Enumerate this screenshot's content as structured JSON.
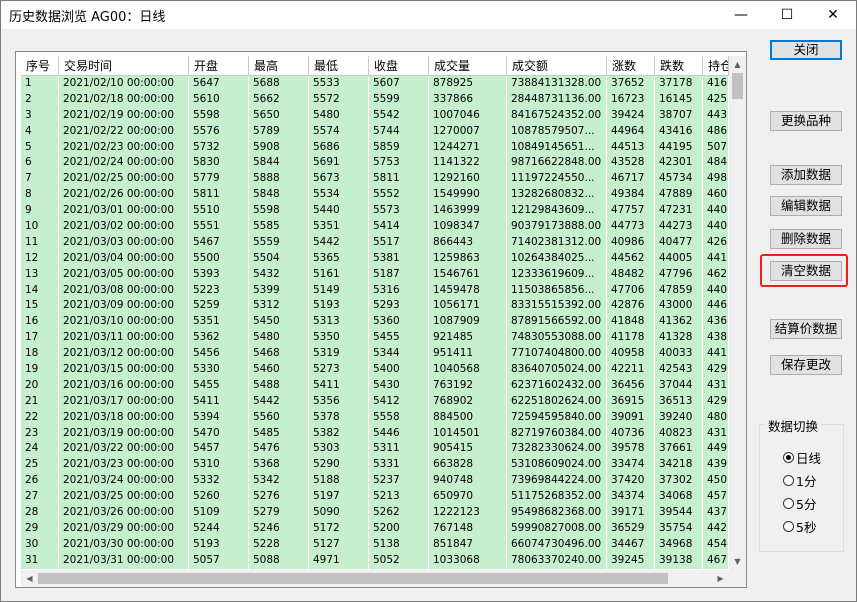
{
  "window": {
    "title": "历史数据浏览 AG00：日线",
    "minimize_glyph": "—",
    "maximize_glyph": "☐",
    "close_glyph": "✕"
  },
  "table": {
    "headers": [
      "序号",
      "交易时间",
      "开盘",
      "最高",
      "最低",
      "收盘",
      "成交量",
      "成交额",
      "涨数",
      "跌数",
      "持仓"
    ],
    "rows": [
      [
        "1",
        "2021/02/10 00:00:00",
        "5647",
        "5688",
        "5533",
        "5607",
        "878925",
        "73884131328.00",
        "37652",
        "37178",
        "416"
      ],
      [
        "2",
        "2021/02/18 00:00:00",
        "5610",
        "5662",
        "5572",
        "5599",
        "337866",
        "28448731136.00",
        "16723",
        "16145",
        "425"
      ],
      [
        "3",
        "2021/02/19 00:00:00",
        "5598",
        "5650",
        "5480",
        "5542",
        "1007046",
        "84167524352.00",
        "39424",
        "38707",
        "443"
      ],
      [
        "4",
        "2021/02/22 00:00:00",
        "5576",
        "5789",
        "5574",
        "5744",
        "1270007",
        "10878579507...",
        "44964",
        "43416",
        "486"
      ],
      [
        "5",
        "2021/02/23 00:00:00",
        "5732",
        "5908",
        "5686",
        "5859",
        "1244271",
        "10849145651...",
        "44513",
        "44195",
        "507"
      ],
      [
        "6",
        "2021/02/24 00:00:00",
        "5830",
        "5844",
        "5691",
        "5753",
        "1141322",
        "98716622848.00",
        "43528",
        "42301",
        "484"
      ],
      [
        "7",
        "2021/02/25 00:00:00",
        "5779",
        "5888",
        "5673",
        "5811",
        "1292160",
        "11197224550...",
        "46717",
        "45734",
        "498"
      ],
      [
        "8",
        "2021/02/26 00:00:00",
        "5811",
        "5848",
        "5534",
        "5552",
        "1549990",
        "13282680832...",
        "49384",
        "47889",
        "460"
      ],
      [
        "9",
        "2021/03/01 00:00:00",
        "5510",
        "5598",
        "5440",
        "5573",
        "1463999",
        "12129843609...",
        "47757",
        "47231",
        "440"
      ],
      [
        "10",
        "2021/03/02 00:00:00",
        "5551",
        "5585",
        "5351",
        "5414",
        "1098347",
        "90379173888.00",
        "44773",
        "44273",
        "440"
      ],
      [
        "11",
        "2021/03/03 00:00:00",
        "5467",
        "5559",
        "5442",
        "5517",
        "866443",
        "71402381312.00",
        "40986",
        "40477",
        "426"
      ],
      [
        "12",
        "2021/03/04 00:00:00",
        "5500",
        "5504",
        "5365",
        "5381",
        "1259863",
        "10264384025...",
        "44562",
        "44005",
        "441"
      ],
      [
        "13",
        "2021/03/05 00:00:00",
        "5393",
        "5432",
        "5161",
        "5187",
        "1546761",
        "12333619609...",
        "48482",
        "47796",
        "462"
      ],
      [
        "14",
        "2021/03/08 00:00:00",
        "5223",
        "5399",
        "5149",
        "5316",
        "1459478",
        "11503865856...",
        "47706",
        "47859",
        "440"
      ],
      [
        "15",
        "2021/03/09 00:00:00",
        "5259",
        "5312",
        "5193",
        "5293",
        "1056171",
        "83315515392.00",
        "42876",
        "43000",
        "446"
      ],
      [
        "16",
        "2021/03/10 00:00:00",
        "5351",
        "5450",
        "5313",
        "5360",
        "1087909",
        "87891566592.00",
        "41848",
        "41362",
        "436"
      ],
      [
        "17",
        "2021/03/11 00:00:00",
        "5362",
        "5480",
        "5350",
        "5455",
        "921485",
        "74830553088.00",
        "41178",
        "41328",
        "438"
      ],
      [
        "18",
        "2021/03/12 00:00:00",
        "5456",
        "5468",
        "5319",
        "5344",
        "951411",
        "77107404800.00",
        "40958",
        "40033",
        "441"
      ],
      [
        "19",
        "2021/03/15 00:00:00",
        "5330",
        "5460",
        "5273",
        "5400",
        "1040568",
        "83640705024.00",
        "42211",
        "42543",
        "429"
      ],
      [
        "20",
        "2021/03/16 00:00:00",
        "5455",
        "5488",
        "5411",
        "5430",
        "763192",
        "62371602432.00",
        "36456",
        "37044",
        "431"
      ],
      [
        "21",
        "2021/03/17 00:00:00",
        "5411",
        "5442",
        "5356",
        "5412",
        "768902",
        "62251802624.00",
        "36915",
        "36513",
        "429"
      ],
      [
        "22",
        "2021/03/18 00:00:00",
        "5394",
        "5560",
        "5378",
        "5558",
        "884500",
        "72594595840.00",
        "39091",
        "39240",
        "480"
      ],
      [
        "23",
        "2021/03/19 00:00:00",
        "5470",
        "5485",
        "5382",
        "5446",
        "1014501",
        "82719760384.00",
        "40736",
        "40823",
        "431"
      ],
      [
        "24",
        "2021/03/22 00:00:00",
        "5457",
        "5476",
        "5303",
        "5311",
        "905415",
        "73282330624.00",
        "39578",
        "37661",
        "449"
      ],
      [
        "25",
        "2021/03/23 00:00:00",
        "5310",
        "5368",
        "5290",
        "5331",
        "663828",
        "53108609024.00",
        "33474",
        "34218",
        "439"
      ],
      [
        "26",
        "2021/03/24 00:00:00",
        "5332",
        "5342",
        "5188",
        "5237",
        "940748",
        "73969844224.00",
        "37420",
        "37302",
        "450"
      ],
      [
        "27",
        "2021/03/25 00:00:00",
        "5260",
        "5276",
        "5197",
        "5213",
        "650970",
        "51175268352.00",
        "34374",
        "34068",
        "457"
      ],
      [
        "28",
        "2021/03/26 00:00:00",
        "5109",
        "5279",
        "5090",
        "5262",
        "1222123",
        "95498682368.00",
        "39171",
        "39544",
        "437"
      ],
      [
        "29",
        "2021/03/29 00:00:00",
        "5244",
        "5246",
        "5172",
        "5200",
        "767148",
        "59990827008.00",
        "36529",
        "35754",
        "442"
      ],
      [
        "30",
        "2021/03/30 00:00:00",
        "5193",
        "5228",
        "5127",
        "5138",
        "851847",
        "66074730496.00",
        "34467",
        "34968",
        "454"
      ],
      [
        "31",
        "2021/03/31 00:00:00",
        "5057",
        "5088",
        "4971",
        "5052",
        "1033068",
        "78063370240.00",
        "39245",
        "39138",
        "467"
      ]
    ]
  },
  "buttons": {
    "close": "关闭",
    "change_product": "更换品种",
    "add_data": "添加数据",
    "edit_data": "编辑数据",
    "delete_data": "删除数据",
    "clear_data": "清空数据",
    "settlement_data": "结算价数据",
    "save_changes": "保存更改"
  },
  "data_switch": {
    "title": "数据切换",
    "options": [
      "日线",
      "1分",
      "5分",
      "5秒"
    ],
    "selected": "日线"
  },
  "colors": {
    "row_background": "#c6efce",
    "highlight_border": "#e8231b"
  }
}
